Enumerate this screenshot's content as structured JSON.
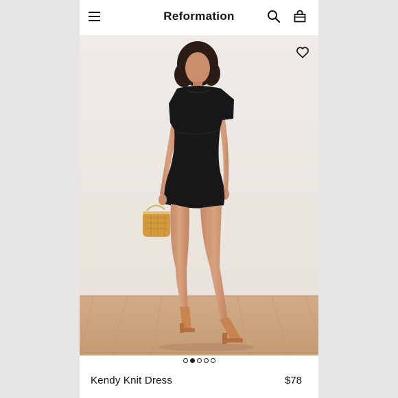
{
  "header": {
    "brand": "Reformation",
    "menu_icon": "hamburger-menu-icon",
    "search_icon": "search-icon",
    "bag_icon": "shopping-bag-icon"
  },
  "hero": {
    "favorite_icon": "heart-icon",
    "image_subject": "model-in-black-knit-dress",
    "carousel": {
      "count": 5,
      "active_index": 1
    }
  },
  "product": {
    "name": "Kendy Knit Dress",
    "price": "$78"
  },
  "colors": {
    "page_background": "#e9e7e5",
    "backdrop": "#ece9e4",
    "floor": "#c9a17c",
    "dress": "#17171a",
    "text": "#111111"
  }
}
